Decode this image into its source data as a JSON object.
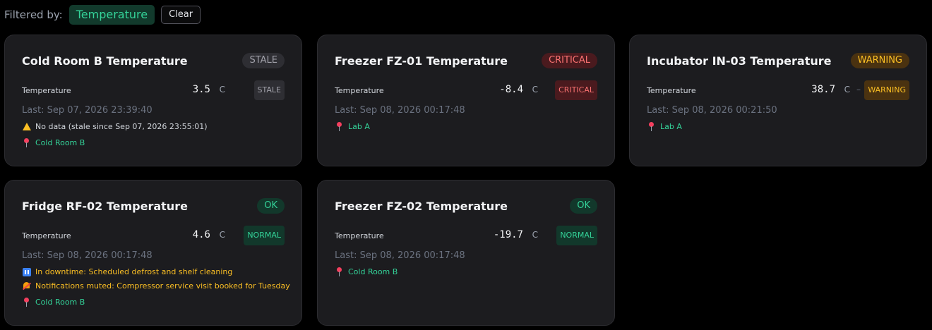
{
  "filter": {
    "label": "Filtered by:",
    "chip": "Temperature",
    "clear_label": "Clear"
  },
  "colors": {
    "background": "#000000",
    "card": "#1c1c1f",
    "ok": "#34d399",
    "critical": "#f87171",
    "warning": "#fbbf24",
    "stale": "#a1a1aa"
  },
  "cards": [
    {
      "title": "Cold Room B Temperature",
      "status": "STALE",
      "metric_name": "Temperature",
      "value": "3.5",
      "unit": "C",
      "metric_badge": "STALE",
      "last": "Last: Sep 07, 2026 23:39:40",
      "warning_icon": "warning-triangle-icon",
      "warning": "No data (stale since Sep 07, 2026 23:55:01)",
      "location_icon": "pin-icon",
      "location": "Cold Room B"
    },
    {
      "title": "Freezer FZ-01 Temperature",
      "status": "CRITICAL",
      "metric_name": "Temperature",
      "value": "-8.4",
      "unit": "C",
      "metric_badge": "CRITICAL",
      "last": "Last: Sep 08, 2026 00:17:48",
      "location_icon": "pin-icon",
      "location": "Lab A"
    },
    {
      "title": "Incubator IN-03 Temperature",
      "status": "WARNING",
      "metric_name": "Temperature",
      "value": "38.7",
      "unit": "C",
      "trend": "–",
      "metric_badge": "WARNING",
      "last": "Last: Sep 08, 2026 00:21:50",
      "location_icon": "pin-icon",
      "location": "Lab A"
    },
    {
      "title": "Fridge RF-02 Temperature",
      "status": "OK",
      "metric_name": "Temperature",
      "value": "4.6",
      "unit": "C",
      "metric_badge": "NORMAL",
      "last": "Last: Sep 08, 2026 00:17:48",
      "downtime_icon": "pause-icon",
      "downtime": "In downtime: Scheduled defrost and shelf cleaning",
      "muted_icon": "bell-muted-icon",
      "muted": "Notifications muted: Compressor service visit booked for Tuesday",
      "location_icon": "pin-icon",
      "location": "Cold Room B"
    },
    {
      "title": "Freezer FZ-02 Temperature",
      "status": "OK",
      "metric_name": "Temperature",
      "value": "-19.7",
      "unit": "C",
      "metric_badge": "NORMAL",
      "last": "Last: Sep 08, 2026 00:17:48",
      "location_icon": "pin-icon",
      "location": "Cold Room B"
    }
  ]
}
